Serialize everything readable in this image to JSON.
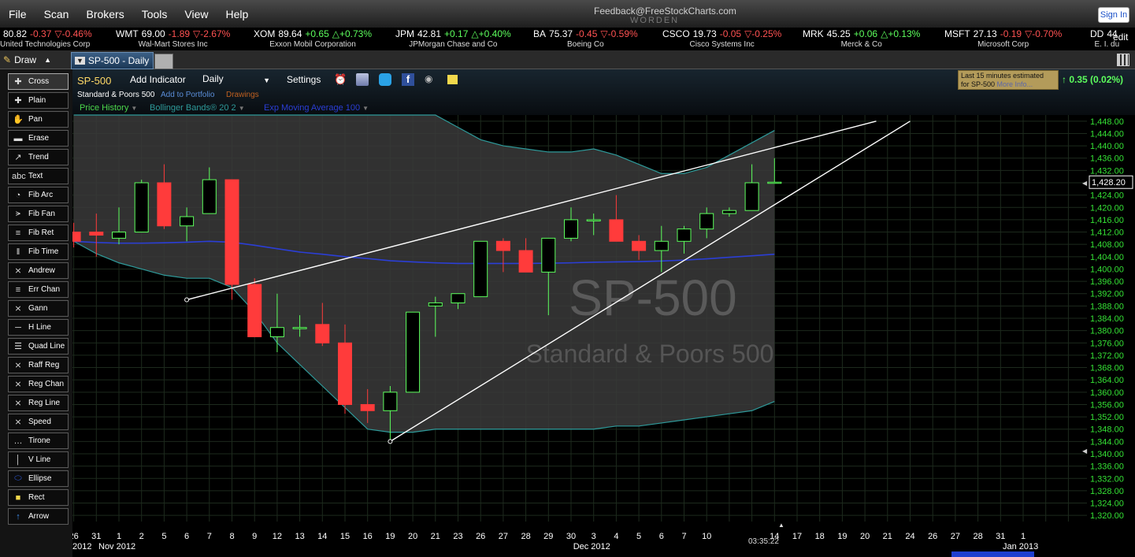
{
  "menubar": {
    "items": [
      "File",
      "Scan",
      "Brokers",
      "Tools",
      "View",
      "Help"
    ],
    "feedback": "Feedback@FreeStockCharts.com",
    "brand": "WORDEN",
    "signin": "Sign In"
  },
  "ticker": {
    "edit": "edit",
    "items": [
      {
        "sym": "",
        "price": "80.82",
        "chg": "-0.37",
        "pct": "-0.46%",
        "dir": "dn",
        "name": "United Technologies Corp"
      },
      {
        "sym": "WMT",
        "price": "69.00",
        "chg": "-1.89",
        "pct": "-2.67%",
        "dir": "dn",
        "name": "Wal-Mart Stores Inc"
      },
      {
        "sym": "XOM",
        "price": "89.64",
        "chg": "+0.65",
        "pct": "+0.73%",
        "dir": "up",
        "name": "Exxon Mobil Corporation"
      },
      {
        "sym": "JPM",
        "price": "42.81",
        "chg": "+0.17",
        "pct": "+0.40%",
        "dir": "up",
        "name": "JPMorgan Chase and Co"
      },
      {
        "sym": "BA",
        "price": "75.37",
        "chg": "-0.45",
        "pct": "-0.59%",
        "dir": "dn",
        "name": "Boeing Co"
      },
      {
        "sym": "CSCO",
        "price": "19.73",
        "chg": "-0.05",
        "pct": "-0.25%",
        "dir": "dn",
        "name": "Cisco Systems Inc"
      },
      {
        "sym": "MRK",
        "price": "45.25",
        "chg": "+0.06",
        "pct": "+0.13%",
        "dir": "up",
        "name": "Merck & Co"
      },
      {
        "sym": "MSFT",
        "price": "27.13",
        "chg": "-0.19",
        "pct": "-0.70%",
        "dir": "dn",
        "name": "Microsoft Corp"
      },
      {
        "sym": "DD",
        "price": "44",
        "chg": "",
        "pct": "",
        "dir": "dn",
        "name": "E. I. du"
      }
    ]
  },
  "tabbar": {
    "draw_label": "Draw",
    "chart_tab": "SP-500 - Daily"
  },
  "tools": [
    "Cross",
    "Plain",
    "Pan",
    "Erase",
    "Trend",
    "Text",
    "Fib Arc",
    "Fib Fan",
    "Fib Ret",
    "Fib Time",
    "Andrew",
    "Err Chan",
    "Gann",
    "H Line",
    "Quad Line",
    "Raff Reg",
    "Reg Chan",
    "Reg Line",
    "Speed",
    "Tirone",
    "V Line",
    "Ellipse",
    "Rect",
    "Arrow"
  ],
  "tool_icons": [
    "crosshair-icon",
    "plain-icon",
    "hand-icon",
    "eraser-icon",
    "trend-icon",
    "text-icon",
    "fib-arc-icon",
    "fib-fan-icon",
    "fib-ret-icon",
    "fib-time-icon",
    "andrew-icon",
    "err-chan-icon",
    "gann-icon",
    "h-line-icon",
    "quad-line-icon",
    "raff-reg-icon",
    "reg-chan-icon",
    "reg-line-icon",
    "speed-icon",
    "tirone-icon",
    "v-line-icon",
    "ellipse-icon",
    "rect-icon",
    "arrow-icon"
  ],
  "chart_header": {
    "symbol": "SP-500",
    "add_indicator": "Add Indicator",
    "period": "Daily",
    "settings": "Settings",
    "fullname": "Standard & Poors 500",
    "add_portfolio": "Add to Portfolio",
    "drawings": "Drawings",
    "ind_price": "Price History",
    "ind_bb": "Bollinger Bands® 20 2",
    "ind_ema": "Exp Moving Average 100",
    "delay_line1": "Last 15 minutes estimated",
    "delay_line2": "for SP-500",
    "more_info": "More Info...",
    "change": "0.35 (0.02%)"
  },
  "colors": {
    "up": "#5dff5d",
    "down": "#ff3b3b",
    "band": "#2e9a9a",
    "ema": "#2b3ed6",
    "trend": "#ffffff"
  },
  "chart_data": {
    "type": "candlestick",
    "watermark_symbol": "SP-500",
    "watermark_name": "Standard & Poors 500",
    "ylim": [
      1318,
      1450
    ],
    "y_ticks": [
      1320,
      1324,
      1328,
      1332,
      1336,
      1340,
      1344,
      1348,
      1352,
      1356,
      1360,
      1364,
      1368,
      1372,
      1376,
      1380,
      1384,
      1388,
      1392,
      1396,
      1400,
      1404,
      1408,
      1412,
      1416,
      1420,
      1424,
      1428,
      1432,
      1436,
      1440,
      1444,
      1448
    ],
    "last_price": "1,428.20",
    "x_labels": [
      "26",
      "31",
      "1",
      "2",
      "5",
      "6",
      "7",
      "8",
      "9",
      "12",
      "13",
      "14",
      "15",
      "16",
      "19",
      "20",
      "21",
      "23",
      "26",
      "27",
      "28",
      "29",
      "30",
      "3",
      "4",
      "5",
      "6",
      "7",
      "10",
      "",
      "",
      "14",
      "17",
      "18",
      "19",
      "20",
      "21",
      "24",
      "26",
      "27",
      "28",
      "31",
      "1"
    ],
    "time_label": "03:35:22",
    "month_labels": [
      {
        "text": "2012",
        "at": 0
      },
      {
        "text": "Nov 2012",
        "at": 2
      },
      {
        "text": "Dec 2012",
        "at": 23
      },
      {
        "text": "Jan 2013",
        "at": 42
      }
    ],
    "candles": [
      {
        "o": 1412,
        "h": 1415,
        "l": 1407,
        "c": 1409
      },
      {
        "o": 1412,
        "h": 1418,
        "l": 1404,
        "c": 1411
      },
      {
        "o": 1410,
        "h": 1420,
        "l": 1408,
        "c": 1412
      },
      {
        "o": 1412,
        "h": 1429,
        "l": 1412,
        "c": 1428
      },
      {
        "o": 1428,
        "h": 1434,
        "l": 1413,
        "c": 1414
      },
      {
        "o": 1414,
        "h": 1420,
        "l": 1409,
        "c": 1417
      },
      {
        "o": 1418,
        "h": 1433,
        "l": 1418,
        "c": 1429
      },
      {
        "o": 1429,
        "h": 1429,
        "l": 1390,
        "c": 1395
      },
      {
        "o": 1395,
        "h": 1397,
        "l": 1378,
        "c": 1378
      },
      {
        "o": 1378,
        "h": 1392,
        "l": 1373,
        "c": 1381
      },
      {
        "o": 1381,
        "h": 1385,
        "l": 1378,
        "c": 1381
      },
      {
        "o": 1382,
        "h": 1389,
        "l": 1375,
        "c": 1376
      },
      {
        "o": 1376,
        "h": 1382,
        "l": 1353,
        "c": 1356
      },
      {
        "o": 1356,
        "h": 1361,
        "l": 1350,
        "c": 1354
      },
      {
        "o": 1354,
        "h": 1362,
        "l": 1344,
        "c": 1360
      },
      {
        "o": 1360,
        "h": 1386,
        "l": 1360,
        "c": 1386
      },
      {
        "o": 1388,
        "h": 1391,
        "l": 1378,
        "c": 1389
      },
      {
        "o": 1389,
        "h": 1391,
        "l": 1387,
        "c": 1392
      },
      {
        "o": 1391,
        "h": 1409,
        "l": 1391,
        "c": 1409
      },
      {
        "o": 1409,
        "h": 1410,
        "l": 1399,
        "c": 1406
      },
      {
        "o": 1406,
        "h": 1410,
        "l": 1400,
        "c": 1399
      },
      {
        "o": 1399,
        "h": 1410,
        "l": 1385,
        "c": 1410
      },
      {
        "o": 1410,
        "h": 1420,
        "l": 1409,
        "c": 1416
      },
      {
        "o": 1416,
        "h": 1418,
        "l": 1411,
        "c": 1416
      },
      {
        "o": 1416,
        "h": 1424,
        "l": 1409,
        "c": 1409
      },
      {
        "o": 1409,
        "h": 1411,
        "l": 1403,
        "c": 1406
      },
      {
        "o": 1406,
        "h": 1414,
        "l": 1399,
        "c": 1409
      },
      {
        "o": 1409,
        "h": 1414,
        "l": 1405,
        "c": 1413
      },
      {
        "o": 1413,
        "h": 1420,
        "l": 1410,
        "c": 1418
      },
      {
        "o": 1418,
        "h": 1420,
        "l": 1417,
        "c": 1419
      },
      {
        "o": 1419,
        "h": 1434,
        "l": 1419,
        "c": 1428
      },
      {
        "o": 1428,
        "h": 1436,
        "l": 1428,
        "c": 1428.2
      }
    ],
    "bb_upper": [
      1460,
      1458,
      1456,
      1454,
      1453,
      1452,
      1452,
      1452,
      1452,
      1452,
      1452,
      1452,
      1452,
      1452,
      1452,
      1452,
      1450,
      1446,
      1442,
      1440,
      1439,
      1438,
      1438,
      1439,
      1437,
      1434,
      1431,
      1431,
      1433,
      1437,
      1441,
      1445
    ],
    "bb_lower": [
      1409,
      1405,
      1402,
      1400,
      1398,
      1397,
      1397,
      1394,
      1386,
      1376,
      1369,
      1362,
      1355,
      1348,
      1347,
      1347,
      1348,
      1348,
      1348,
      1348,
      1348,
      1348,
      1348,
      1348,
      1349,
      1349,
      1350,
      1351,
      1352,
      1353,
      1354,
      1357
    ],
    "ema": [
      1409,
      1408.6,
      1408.4,
      1408.4,
      1408.5,
      1408.7,
      1409,
      1408.7,
      1407.7,
      1406.6,
      1405.5,
      1404.8,
      1404,
      1403.4,
      1402.7,
      1402.3,
      1402,
      1401.8,
      1401.8,
      1401.8,
      1401.8,
      1401.9,
      1402,
      1402.2,
      1402.3,
      1402.4,
      1402.6,
      1402.9,
      1403.3,
      1403.8,
      1404.3,
      1404.8
    ],
    "trendlines": [
      {
        "from": {
          "i": 5,
          "v": 1390
        },
        "to": {
          "i": 35.5,
          "v": 1448
        }
      },
      {
        "from": {
          "i": 14,
          "v": 1344
        },
        "to": {
          "i": 37,
          "v": 1448
        }
      }
    ]
  }
}
